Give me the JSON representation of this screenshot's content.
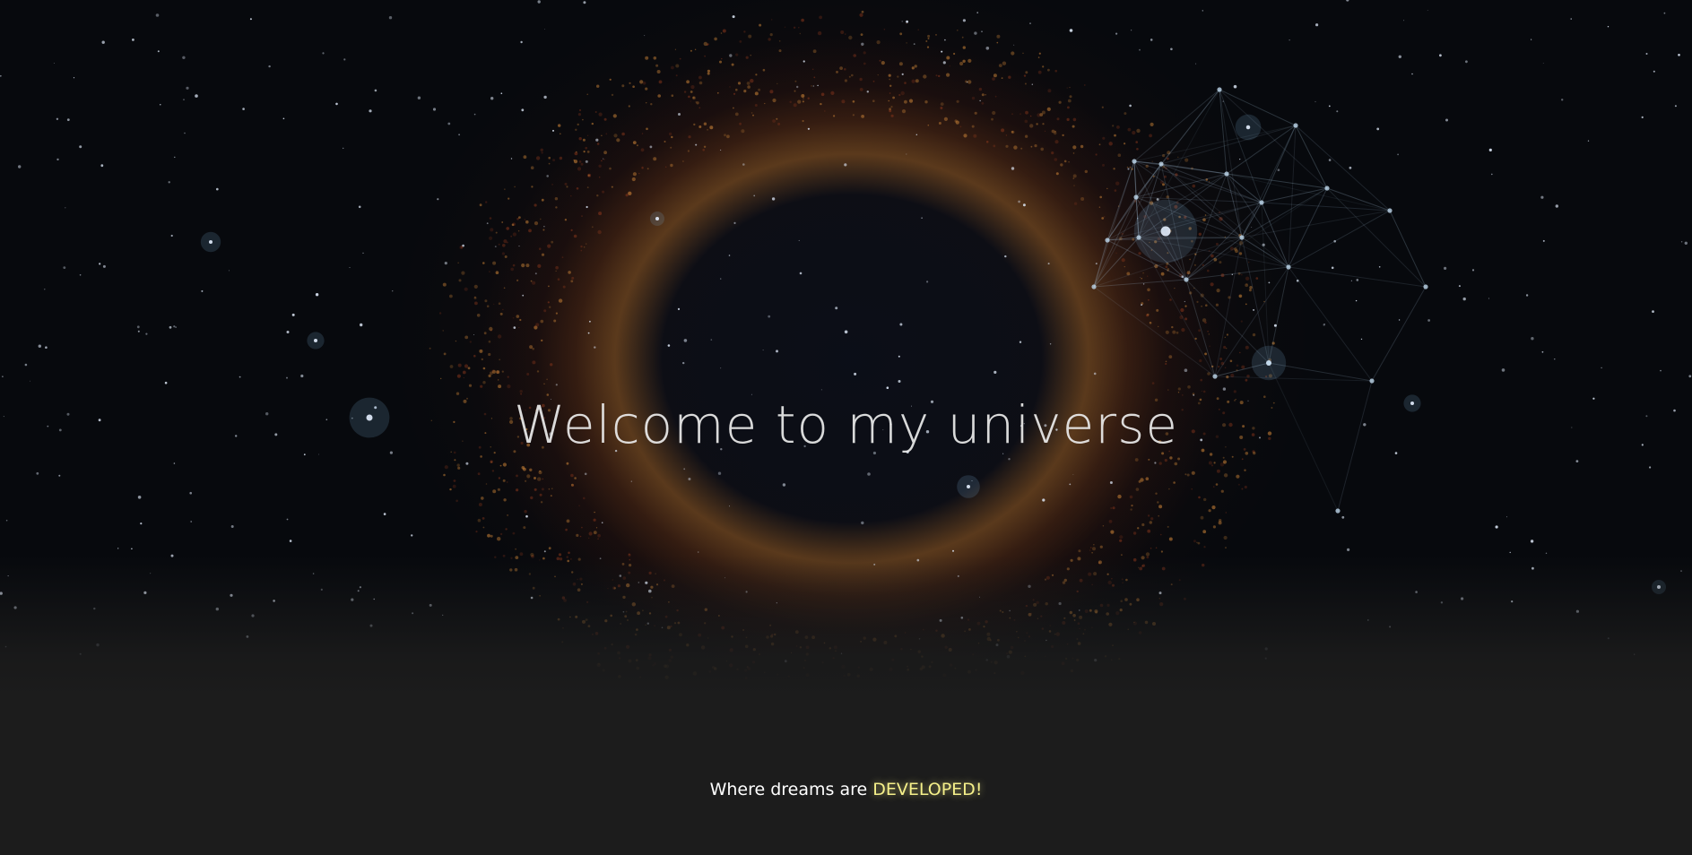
{
  "hero": {
    "title": "Welcome to my universe"
  },
  "tagline": {
    "prefix": "Where dreams are ",
    "highlight": "DEVELOPED!"
  },
  "colors": {
    "background": "#1c1c1c",
    "highlight": "#f5f08a",
    "text": "#ffffff"
  }
}
